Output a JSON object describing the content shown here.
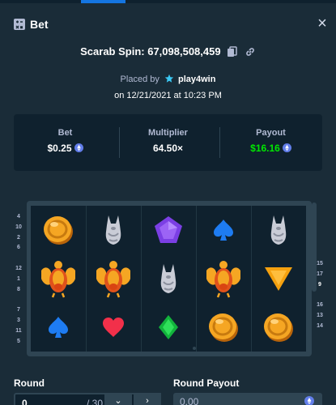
{
  "window": {
    "title": "Bet",
    "close_glyph": "×"
  },
  "game": {
    "label": "Scarab Spin: 67,098,508,459"
  },
  "placed": {
    "prefix": "Placed by",
    "user": "play4win",
    "date": "on 12/21/2021 at 10:23 PM"
  },
  "stats": {
    "bet_label": "Bet",
    "bet_value": "$0.25",
    "multiplier_label": "Multiplier",
    "multiplier_value": "64.50×",
    "payout_label": "Payout",
    "payout_value": "$16.16"
  },
  "colors": {
    "background": "#1a2c38",
    "panel": "#0f212e",
    "accent": "#1475e1",
    "payout_green": "#00e701",
    "muted_text": "#b1bad3"
  },
  "paylines": {
    "left": [
      "4",
      "10",
      "2",
      "6",
      "",
      "12",
      "1",
      "8",
      "",
      "7",
      "3",
      "11",
      "5"
    ],
    "left_highlight": [
      false,
      false,
      false,
      false,
      false,
      false,
      false,
      false,
      false,
      false,
      false,
      false,
      false
    ],
    "right": [
      "15",
      "17",
      "9",
      "",
      "16",
      "13",
      "14"
    ],
    "right_highlight": [
      false,
      false,
      true,
      false,
      false,
      false,
      false
    ]
  },
  "reels": [
    [
      "coin-icon",
      "jackal-icon",
      "purple-gem-icon",
      "spade-icon",
      "jackal-icon"
    ],
    [
      "scarab-icon",
      "scarab-icon",
      "jackal-icon",
      "scarab-icon",
      "orange-triangle-icon"
    ],
    [
      "spade-icon",
      "heart-icon",
      "green-diamond-icon",
      "coin-icon",
      "coin-icon"
    ]
  ],
  "round": {
    "label": "Round",
    "value": "0",
    "of_text": "/ 30",
    "prev_glyph": "⌄",
    "next_glyph": "›"
  },
  "round_payout": {
    "label": "Round Payout",
    "value": "0.00"
  }
}
